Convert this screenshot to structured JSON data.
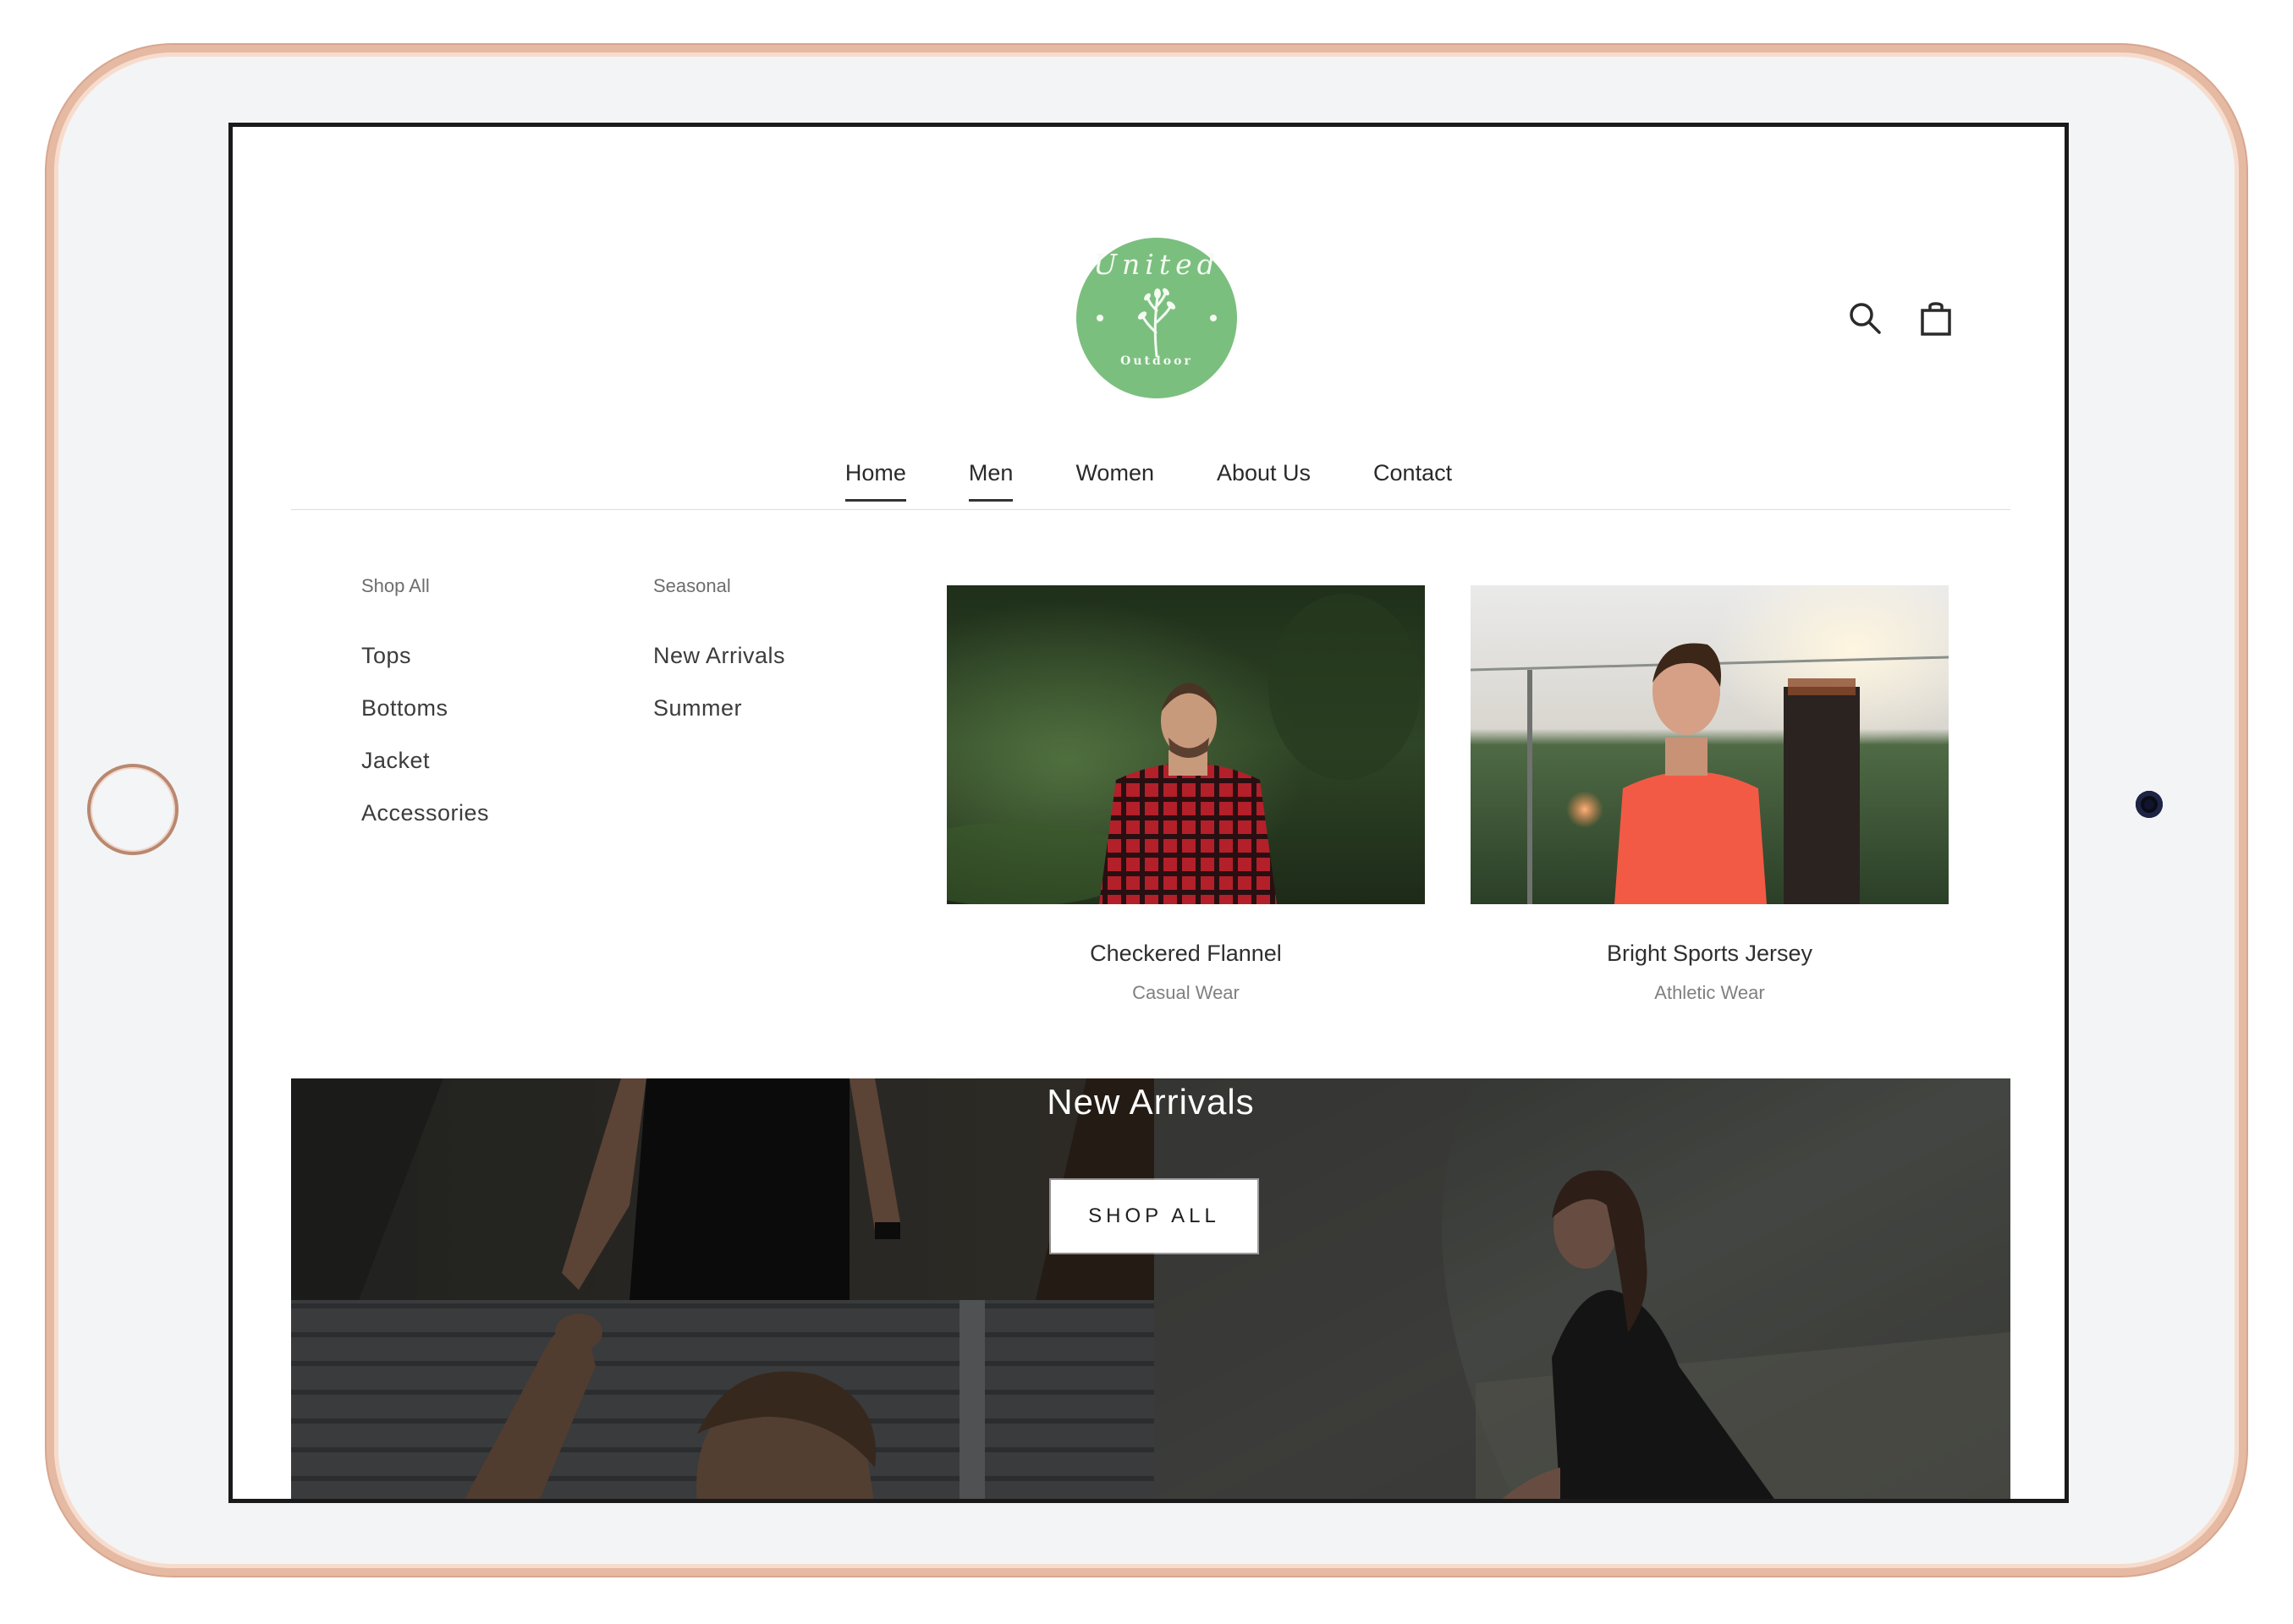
{
  "brand": {
    "logo_top_word": "United",
    "logo_bottom_word": "Outdoor",
    "logo_color": "#7bbf7f"
  },
  "header": {
    "icons": [
      "search-icon",
      "shopping-bag-icon"
    ]
  },
  "nav": {
    "items": [
      {
        "label": "Home",
        "active": true
      },
      {
        "label": "Men",
        "active": true
      },
      {
        "label": "Women",
        "active": false
      },
      {
        "label": "About Us",
        "active": false
      },
      {
        "label": "Contact",
        "active": false
      }
    ]
  },
  "mega_menu": {
    "shop_all": {
      "title": "Shop All",
      "links": [
        "Tops",
        "Bottoms",
        "Jacket",
        "Accessories"
      ]
    },
    "seasonal": {
      "title": "Seasonal",
      "links": [
        "New Arrivals",
        "Summer"
      ]
    },
    "products": [
      {
        "name": "Checkered Flannel",
        "category": "Casual Wear"
      },
      {
        "name": "Bright Sports Jersey",
        "category": "Athletic Wear"
      }
    ]
  },
  "hero": {
    "title": "New Arrivals",
    "button_label": "SHOP ALL"
  },
  "colors": {
    "frame": "#e5b9a2",
    "nav_underline": "#333333"
  }
}
